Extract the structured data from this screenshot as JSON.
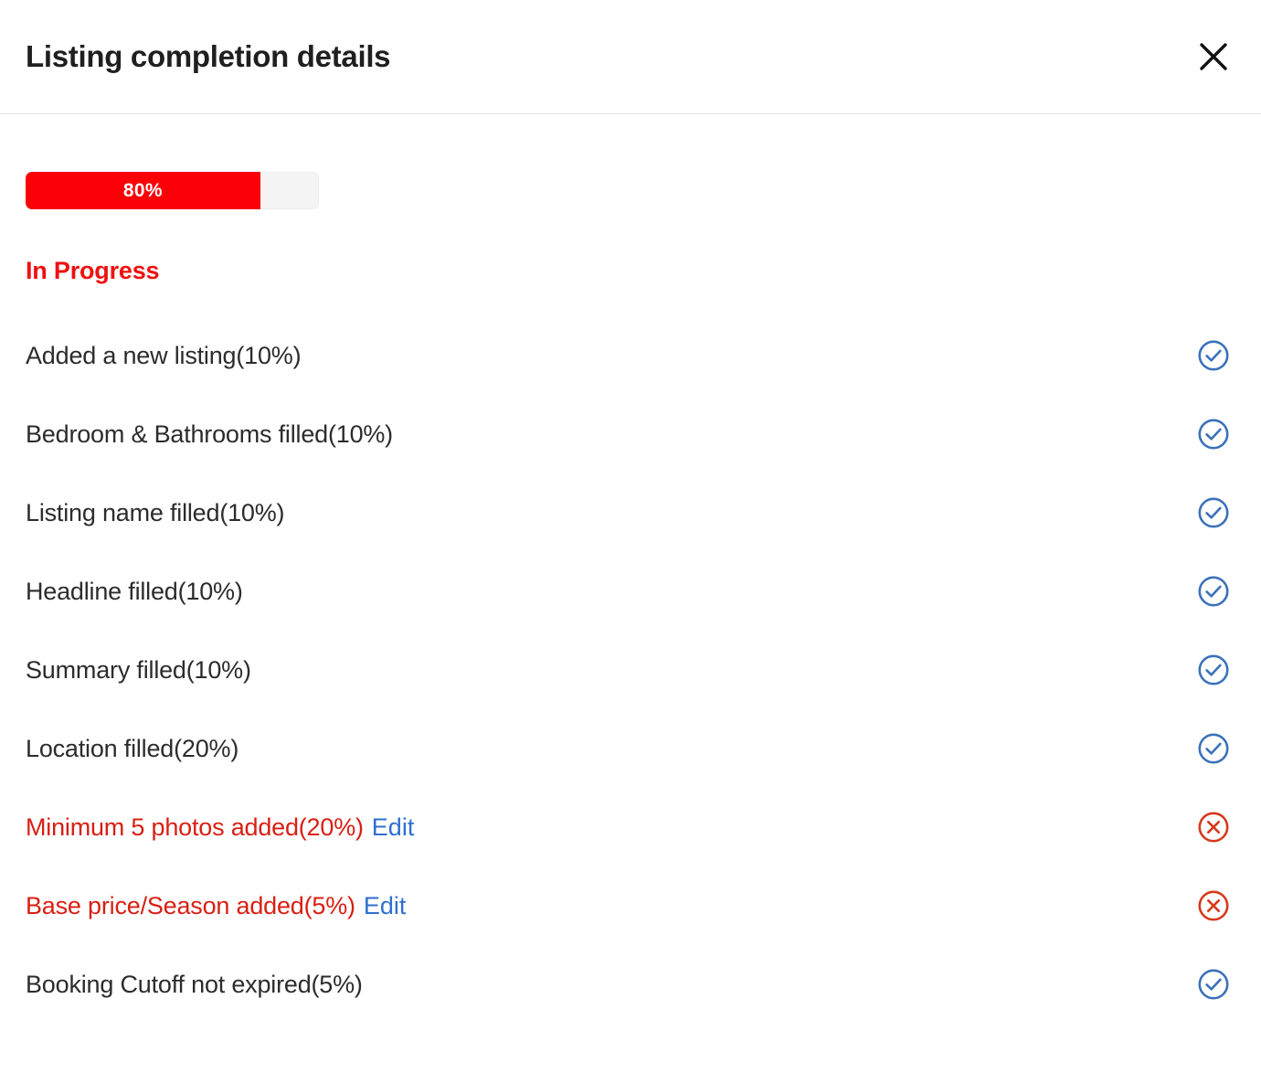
{
  "header": {
    "title": "Listing completion details",
    "close_icon": "close-icon",
    "close_label": "Close"
  },
  "progress": {
    "percent": 80,
    "label": "80%",
    "fill_color": "#fb0007",
    "track_color": "#f4f4f4"
  },
  "status": {
    "label": "In Progress",
    "color": "#ee1111"
  },
  "colors": {
    "success_icon": "#3b71b9",
    "failure_icon": "#d6391b",
    "failed_text": "#d81f13",
    "link": "#2f6fd0",
    "body_text": "#2c2c2c"
  },
  "edit_label": "Edit",
  "checklist": [
    {
      "label": "Added a new listing(10%)",
      "state": "complete",
      "icon": "check-circle-icon",
      "weight": "10%",
      "has_edit": false
    },
    {
      "label": "Bedroom & Bathrooms filled(10%)",
      "state": "complete",
      "icon": "check-circle-icon",
      "weight": "10%",
      "has_edit": false
    },
    {
      "label": "Listing name filled(10%)",
      "state": "complete",
      "icon": "check-circle-icon",
      "weight": "10%",
      "has_edit": false
    },
    {
      "label": "Headline filled(10%)",
      "state": "complete",
      "icon": "check-circle-icon",
      "weight": "10%",
      "has_edit": false
    },
    {
      "label": "Summary filled(10%)",
      "state": "complete",
      "icon": "check-circle-icon",
      "weight": "10%",
      "has_edit": false
    },
    {
      "label": "Location filled(20%)",
      "state": "complete",
      "icon": "check-circle-icon",
      "weight": "20%",
      "has_edit": false
    },
    {
      "label": "Minimum 5 photos added(20%)",
      "state": "incomplete",
      "icon": "error-circle-icon",
      "weight": "20%",
      "has_edit": true
    },
    {
      "label": "Base price/Season added(5%)",
      "state": "incomplete",
      "icon": "error-circle-icon",
      "weight": "5%",
      "has_edit": true
    },
    {
      "label": "Booking Cutoff not expired(5%)",
      "state": "complete",
      "icon": "check-circle-icon",
      "weight": "5%",
      "has_edit": false
    }
  ]
}
